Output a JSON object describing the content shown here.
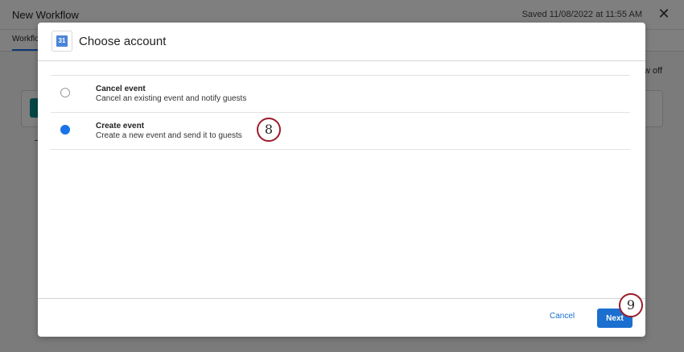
{
  "app": {
    "title": "New Workflow",
    "saved_status": "Saved 11/08/2022 at 11:55 AM",
    "close_glyph": "✕",
    "tab_label": "Workflo",
    "right_text": "w off"
  },
  "modal": {
    "calendar_icon_text": "31",
    "title": "Choose account",
    "options": [
      {
        "title": "Cancel event",
        "description": "Cancel an existing event and notify guests",
        "selected": false
      },
      {
        "title": "Create event",
        "description": "Create a new event and send it to guests",
        "selected": true
      }
    ],
    "cancel_label": "Cancel",
    "next_label": "Next"
  },
  "annotations": {
    "step_8": "8",
    "step_9": "9"
  },
  "colors": {
    "accent": "#1a6fcf",
    "badge_border": "#9b1c2c",
    "overlay": "rgba(0,0,0,0.5)"
  },
  "icons": {
    "close": "close-icon",
    "calendar": "google-calendar-icon"
  }
}
